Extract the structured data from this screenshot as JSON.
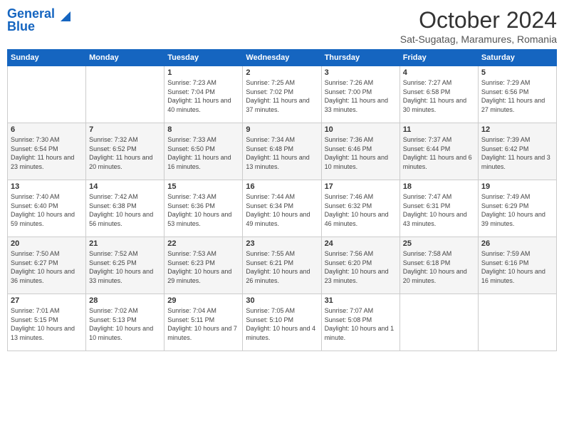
{
  "header": {
    "logo_line1": "General",
    "logo_line2": "Blue",
    "month": "October 2024",
    "location": "Sat-Sugatag, Maramures, Romania"
  },
  "days_of_week": [
    "Sunday",
    "Monday",
    "Tuesday",
    "Wednesday",
    "Thursday",
    "Friday",
    "Saturday"
  ],
  "weeks": [
    [
      {
        "day": "",
        "content": ""
      },
      {
        "day": "",
        "content": ""
      },
      {
        "day": "1",
        "content": "Sunrise: 7:23 AM\nSunset: 7:04 PM\nDaylight: 11 hours\nand 40 minutes."
      },
      {
        "day": "2",
        "content": "Sunrise: 7:25 AM\nSunset: 7:02 PM\nDaylight: 11 hours\nand 37 minutes."
      },
      {
        "day": "3",
        "content": "Sunrise: 7:26 AM\nSunset: 7:00 PM\nDaylight: 11 hours\nand 33 minutes."
      },
      {
        "day": "4",
        "content": "Sunrise: 7:27 AM\nSunset: 6:58 PM\nDaylight: 11 hours\nand 30 minutes."
      },
      {
        "day": "5",
        "content": "Sunrise: 7:29 AM\nSunset: 6:56 PM\nDaylight: 11 hours\nand 27 minutes."
      }
    ],
    [
      {
        "day": "6",
        "content": "Sunrise: 7:30 AM\nSunset: 6:54 PM\nDaylight: 11 hours\nand 23 minutes."
      },
      {
        "day": "7",
        "content": "Sunrise: 7:32 AM\nSunset: 6:52 PM\nDaylight: 11 hours\nand 20 minutes."
      },
      {
        "day": "8",
        "content": "Sunrise: 7:33 AM\nSunset: 6:50 PM\nDaylight: 11 hours\nand 16 minutes."
      },
      {
        "day": "9",
        "content": "Sunrise: 7:34 AM\nSunset: 6:48 PM\nDaylight: 11 hours\nand 13 minutes."
      },
      {
        "day": "10",
        "content": "Sunrise: 7:36 AM\nSunset: 6:46 PM\nDaylight: 11 hours\nand 10 minutes."
      },
      {
        "day": "11",
        "content": "Sunrise: 7:37 AM\nSunset: 6:44 PM\nDaylight: 11 hours\nand 6 minutes."
      },
      {
        "day": "12",
        "content": "Sunrise: 7:39 AM\nSunset: 6:42 PM\nDaylight: 11 hours\nand 3 minutes."
      }
    ],
    [
      {
        "day": "13",
        "content": "Sunrise: 7:40 AM\nSunset: 6:40 PM\nDaylight: 10 hours\nand 59 minutes."
      },
      {
        "day": "14",
        "content": "Sunrise: 7:42 AM\nSunset: 6:38 PM\nDaylight: 10 hours\nand 56 minutes."
      },
      {
        "day": "15",
        "content": "Sunrise: 7:43 AM\nSunset: 6:36 PM\nDaylight: 10 hours\nand 53 minutes."
      },
      {
        "day": "16",
        "content": "Sunrise: 7:44 AM\nSunset: 6:34 PM\nDaylight: 10 hours\nand 49 minutes."
      },
      {
        "day": "17",
        "content": "Sunrise: 7:46 AM\nSunset: 6:32 PM\nDaylight: 10 hours\nand 46 minutes."
      },
      {
        "day": "18",
        "content": "Sunrise: 7:47 AM\nSunset: 6:31 PM\nDaylight: 10 hours\nand 43 minutes."
      },
      {
        "day": "19",
        "content": "Sunrise: 7:49 AM\nSunset: 6:29 PM\nDaylight: 10 hours\nand 39 minutes."
      }
    ],
    [
      {
        "day": "20",
        "content": "Sunrise: 7:50 AM\nSunset: 6:27 PM\nDaylight: 10 hours\nand 36 minutes."
      },
      {
        "day": "21",
        "content": "Sunrise: 7:52 AM\nSunset: 6:25 PM\nDaylight: 10 hours\nand 33 minutes."
      },
      {
        "day": "22",
        "content": "Sunrise: 7:53 AM\nSunset: 6:23 PM\nDaylight: 10 hours\nand 29 minutes."
      },
      {
        "day": "23",
        "content": "Sunrise: 7:55 AM\nSunset: 6:21 PM\nDaylight: 10 hours\nand 26 minutes."
      },
      {
        "day": "24",
        "content": "Sunrise: 7:56 AM\nSunset: 6:20 PM\nDaylight: 10 hours\nand 23 minutes."
      },
      {
        "day": "25",
        "content": "Sunrise: 7:58 AM\nSunset: 6:18 PM\nDaylight: 10 hours\nand 20 minutes."
      },
      {
        "day": "26",
        "content": "Sunrise: 7:59 AM\nSunset: 6:16 PM\nDaylight: 10 hours\nand 16 minutes."
      }
    ],
    [
      {
        "day": "27",
        "content": "Sunrise: 7:01 AM\nSunset: 5:15 PM\nDaylight: 10 hours\nand 13 minutes."
      },
      {
        "day": "28",
        "content": "Sunrise: 7:02 AM\nSunset: 5:13 PM\nDaylight: 10 hours\nand 10 minutes."
      },
      {
        "day": "29",
        "content": "Sunrise: 7:04 AM\nSunset: 5:11 PM\nDaylight: 10 hours\nand 7 minutes."
      },
      {
        "day": "30",
        "content": "Sunrise: 7:05 AM\nSunset: 5:10 PM\nDaylight: 10 hours\nand 4 minutes."
      },
      {
        "day": "31",
        "content": "Sunrise: 7:07 AM\nSunset: 5:08 PM\nDaylight: 10 hours\nand 1 minute."
      },
      {
        "day": "",
        "content": ""
      },
      {
        "day": "",
        "content": ""
      }
    ]
  ]
}
